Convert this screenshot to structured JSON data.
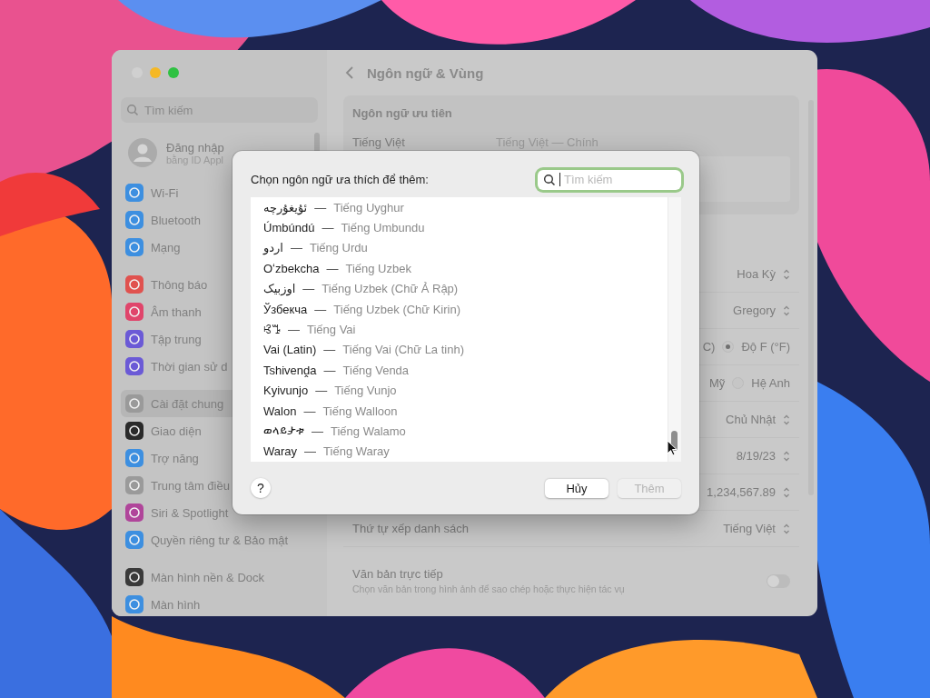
{
  "window": {
    "title": "Ngôn ngữ & Vùng"
  },
  "sidebar": {
    "search_placeholder": "Tìm kiếm",
    "account": {
      "name": "Đăng nhập",
      "subtitle": "bằng ID Appl"
    },
    "groups": [
      [
        {
          "label": "Wi-Fi",
          "selected": false,
          "color": "#3d8fe0"
        },
        {
          "label": "Bluetooth",
          "selected": false,
          "color": "#3d8fe0"
        },
        {
          "label": "Mạng",
          "selected": false,
          "color": "#3d8fe0"
        }
      ],
      [
        {
          "label": "Thông báo",
          "selected": false,
          "color": "#e0524f"
        },
        {
          "label": "Âm thanh",
          "selected": false,
          "color": "#e0456b"
        },
        {
          "label": "Tập trung",
          "selected": false,
          "color": "#6b5ad6"
        },
        {
          "label": "Thời gian sử d",
          "selected": false,
          "color": "#6b5ad6"
        }
      ],
      [
        {
          "label": "Cài đặt chung",
          "selected": true,
          "color": "#9a9a9a"
        },
        {
          "label": "Giao diện",
          "selected": false,
          "color": "#2a2a2a"
        },
        {
          "label": "Trợ năng",
          "selected": false,
          "color": "#3d8fe0"
        },
        {
          "label": "Trung tâm điều",
          "selected": false,
          "color": "#9a9a9a"
        },
        {
          "label": "Siri & Spotlight",
          "selected": false,
          "color": "#b0459a"
        },
        {
          "label": "Quyền riêng tư & Bảo mật",
          "selected": false,
          "color": "#3d8fe0"
        }
      ],
      [
        {
          "label": "Màn hình nền & Dock",
          "selected": false,
          "color": "#3a3a3a"
        },
        {
          "label": "Màn hình",
          "selected": false,
          "color": "#3d8fe0"
        }
      ]
    ]
  },
  "preferred_languages": {
    "heading": "Ngôn ngữ ưu tiên",
    "items": [
      {
        "name": "Tiếng Việt",
        "detail": "Tiếng Việt — Chính"
      }
    ]
  },
  "settings": [
    {
      "kind": "popup",
      "value": "Hoa Kỳ"
    },
    {
      "kind": "popup",
      "value": "Gregory"
    },
    {
      "kind": "radio",
      "options": [
        {
          "label": "C)"
        },
        {
          "label": "Độ F (°F)",
          "selected": true
        }
      ]
    },
    {
      "kind": "radio",
      "options": [
        {
          "label": "Mỹ"
        },
        {
          "label": "Hệ Anh",
          "selected": false
        }
      ]
    },
    {
      "kind": "popup",
      "value": "Chủ Nhật"
    },
    {
      "kind": "popup",
      "value": "8/19/23"
    },
    {
      "kind": "popup",
      "value": "1,234,567.89"
    },
    {
      "kind": "popup",
      "label": "Thứ tự xếp danh sách",
      "value": "Tiếng Việt"
    }
  ],
  "live_text": {
    "label": "Văn bản trực tiếp",
    "description": "Chọn văn bản trong hình ảnh để sao chép hoặc thực hiện tác vụ",
    "on": false
  },
  "dialog": {
    "prompt": "Chọn ngôn ngữ ưa thích để thêm:",
    "search_placeholder": "Tìm kiếm",
    "languages": [
      {
        "native": "ئۇيغۇرچە",
        "separator": "—",
        "name": "Tiếng Uyghur"
      },
      {
        "native": "Úmbúndú",
        "separator": "—",
        "name": "Tiếng Umbundu"
      },
      {
        "native": "اردو",
        "separator": "—",
        "name": "Tiếng Urdu"
      },
      {
        "native": "Oʻzbekcha",
        "separator": "—",
        "name": "Tiếng Uzbek"
      },
      {
        "native": "اوزبیک",
        "separator": "—",
        "name": "Tiếng Uzbek (Chữ Ả Rập)"
      },
      {
        "native": "Ўзбекча",
        "separator": "—",
        "name": "Tiếng Uzbek (Chữ Kirin)"
      },
      {
        "native": "ꕙꔤ",
        "separator": "—",
        "name": "Tiếng Vai"
      },
      {
        "native": "Vai (Latin)",
        "separator": "—",
        "name": "Tiếng Vai (Chữ La tinh)"
      },
      {
        "native": "Tshivenḓa",
        "separator": "—",
        "name": "Tiếng Venda"
      },
      {
        "native": "Kyivunjo",
        "separator": "—",
        "name": "Tiếng Vunjo"
      },
      {
        "native": "Walon",
        "separator": "—",
        "name": "Tiếng Walloon"
      },
      {
        "native": "ወላይታቱ",
        "separator": "—",
        "name": "Tiếng Walamo"
      },
      {
        "native": "Waray",
        "separator": "—",
        "name": "Tiếng Waray"
      }
    ],
    "help": "?",
    "cancel": "Hủy",
    "add": {
      "label": "Thêm",
      "disabled": true
    }
  }
}
